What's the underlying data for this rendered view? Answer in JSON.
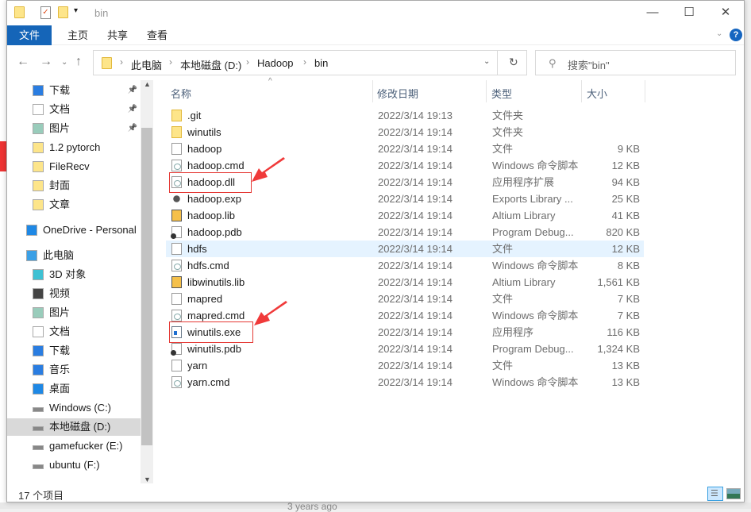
{
  "window": {
    "title": "bin"
  },
  "ribbon": {
    "tabs": [
      "文件",
      "主页",
      "共享",
      "查看"
    ]
  },
  "address": {
    "crumbs": [
      "此电脑",
      "本地磁盘 (D:)",
      "Hadoop",
      "bin"
    ]
  },
  "search": {
    "placeholder": "搜索\"bin\""
  },
  "nav": [
    {
      "label": "下载",
      "icon": "download-icon",
      "pinned": true
    },
    {
      "label": "文档",
      "icon": "document-icon",
      "pinned": true
    },
    {
      "label": "图片",
      "icon": "pictures-icon",
      "pinned": true
    },
    {
      "label": "1.2 pytorch",
      "icon": "folder-icon"
    },
    {
      "label": "FileRecv",
      "icon": "folder-icon"
    },
    {
      "label": "封面",
      "icon": "folder-icon"
    },
    {
      "label": "文章",
      "icon": "folder-icon"
    },
    {
      "label": "OneDrive - Personal",
      "icon": "onedrive-icon",
      "top": true
    },
    {
      "label": "此电脑",
      "icon": "computer-icon",
      "top": true
    },
    {
      "label": "3D 对象",
      "icon": "3d-objects-icon"
    },
    {
      "label": "视频",
      "icon": "video-icon"
    },
    {
      "label": "图片",
      "icon": "pictures-icon"
    },
    {
      "label": "文档",
      "icon": "document-icon"
    },
    {
      "label": "下载",
      "icon": "download-icon"
    },
    {
      "label": "音乐",
      "icon": "music-icon"
    },
    {
      "label": "桌面",
      "icon": "desktop-icon"
    },
    {
      "label": "Windows (C:)",
      "icon": "drive-icon"
    },
    {
      "label": "本地磁盘 (D:)",
      "icon": "drive-icon",
      "selected": true
    },
    {
      "label": "gamefucker (E:)",
      "icon": "drive-icon"
    },
    {
      "label": "ubuntu (F:)",
      "icon": "drive-icon"
    }
  ],
  "columns": [
    "名称",
    "修改日期",
    "类型",
    "大小"
  ],
  "files": [
    {
      "name": ".git",
      "date": "2022/3/14 19:13",
      "type": "文件夹",
      "size": "",
      "icon": "folder"
    },
    {
      "name": "winutils",
      "date": "2022/3/14 19:14",
      "type": "文件夹",
      "size": "",
      "icon": "folder"
    },
    {
      "name": "hadoop",
      "date": "2022/3/14 19:14",
      "type": "文件",
      "size": "9 KB",
      "icon": "file"
    },
    {
      "name": "hadoop.cmd",
      "date": "2022/3/14 19:14",
      "type": "Windows 命令脚本",
      "size": "12 KB",
      "icon": "cmd"
    },
    {
      "name": "hadoop.dll",
      "date": "2022/3/14 19:14",
      "type": "应用程序扩展",
      "size": "94 KB",
      "icon": "dll"
    },
    {
      "name": "hadoop.exp",
      "date": "2022/3/14 19:14",
      "type": "Exports Library ...",
      "size": "25 KB",
      "icon": "exp"
    },
    {
      "name": "hadoop.lib",
      "date": "2022/3/14 19:14",
      "type": "Altium Library",
      "size": "41 KB",
      "icon": "lib"
    },
    {
      "name": "hadoop.pdb",
      "date": "2022/3/14 19:14",
      "type": "Program Debug...",
      "size": "820 KB",
      "icon": "pdb"
    },
    {
      "name": "hdfs",
      "date": "2022/3/14 19:14",
      "type": "文件",
      "size": "12 KB",
      "icon": "file",
      "hover": true
    },
    {
      "name": "hdfs.cmd",
      "date": "2022/3/14 19:14",
      "type": "Windows 命令脚本",
      "size": "8 KB",
      "icon": "cmd"
    },
    {
      "name": "libwinutils.lib",
      "date": "2022/3/14 19:14",
      "type": "Altium Library",
      "size": "1,561 KB",
      "icon": "lib"
    },
    {
      "name": "mapred",
      "date": "2022/3/14 19:14",
      "type": "文件",
      "size": "7 KB",
      "icon": "file"
    },
    {
      "name": "mapred.cmd",
      "date": "2022/3/14 19:14",
      "type": "Windows 命令脚本",
      "size": "7 KB",
      "icon": "cmd"
    },
    {
      "name": "winutils.exe",
      "date": "2022/3/14 19:14",
      "type": "应用程序",
      "size": "116 KB",
      "icon": "exe"
    },
    {
      "name": "winutils.pdb",
      "date": "2022/3/14 19:14",
      "type": "Program Debug...",
      "size": "1,324 KB",
      "icon": "pdb"
    },
    {
      "name": "yarn",
      "date": "2022/3/14 19:14",
      "type": "文件",
      "size": "13 KB",
      "icon": "file"
    },
    {
      "name": "yarn.cmd",
      "date": "2022/3/14 19:14",
      "type": "Windows 命令脚本",
      "size": "13 KB",
      "icon": "cmd"
    }
  ],
  "status": {
    "count": "17 个项目"
  },
  "background": {
    "behind_text": "3 years ago"
  }
}
